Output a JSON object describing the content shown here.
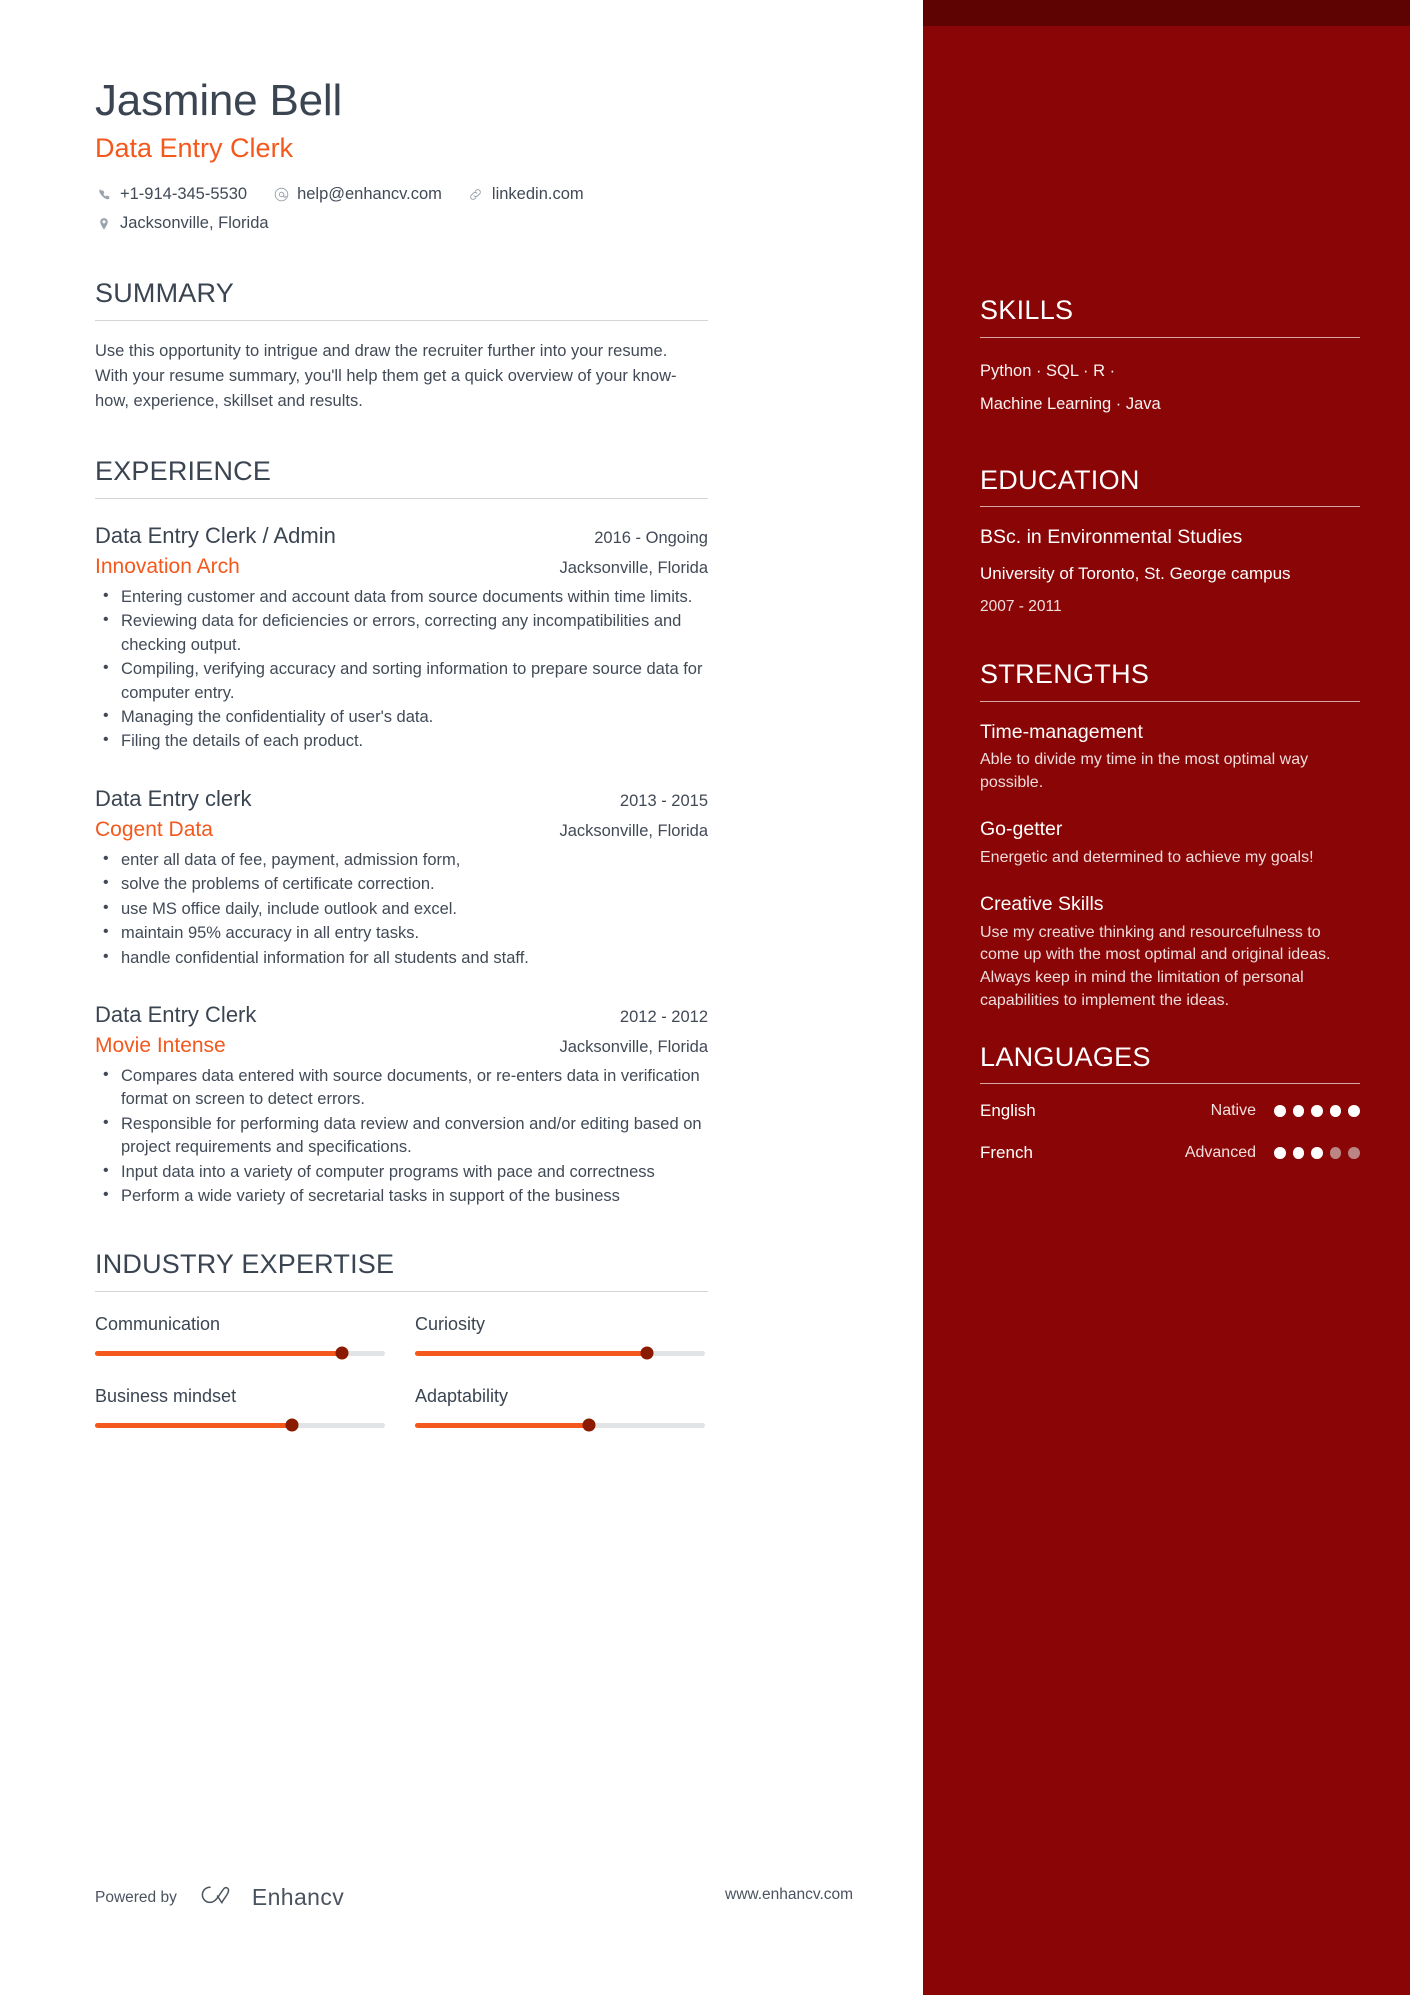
{
  "theme": {
    "accent_orange": "#f4581c",
    "sidebar_red": "#8a0505",
    "sidebar_top_strip": "#5f0202",
    "text_dark": "#3b4552",
    "knob_dark_red": "#8a1a00"
  },
  "header": {
    "name": "Jasmine Bell",
    "role": "Data Entry Clerk",
    "contacts": [
      {
        "icon": "phone-icon",
        "text": "+1-914-345-5530"
      },
      {
        "icon": "email-icon",
        "text": "help@enhancv.com"
      },
      {
        "icon": "link-icon",
        "text": "linkedin.com"
      },
      {
        "icon": "location-icon",
        "text": "Jacksonville, Florida"
      }
    ]
  },
  "summary": {
    "title": "SUMMARY",
    "text": "Use this opportunity to intrigue and draw the recruiter further into your resume. With your resume summary, you'll help them get a quick overview of your know-how, experience, skillset and results."
  },
  "experience": {
    "title": "EXPERIENCE",
    "jobs": [
      {
        "title": "Data Entry Clerk / Admin",
        "dates": "2016 - Ongoing",
        "company": "Innovation Arch",
        "location": "Jacksonville, Florida",
        "bullets": [
          "Entering customer and account data from source documents within time limits.",
          "Reviewing data for deficiencies or errors, correcting any incompatibilities and checking output.",
          "Compiling, verifying accuracy and sorting information to prepare source data for computer entry.",
          "Managing the confidentiality of user's data.",
          "Filing the details of each product."
        ]
      },
      {
        "title": "Data Entry clerk",
        "dates": "2013 - 2015",
        "company": "Cogent Data",
        "location": "Jacksonville, Florida",
        "bullets": [
          "enter all data of fee, payment, admission form,",
          "solve the problems of certificate correction.",
          "use MS office daily, include outlook and excel.",
          "maintain 95% accuracy in all entry tasks.",
          "handle confidential information for all students and staff."
        ]
      },
      {
        "title": "Data Entry Clerk",
        "dates": "2012 - 2012",
        "company": "Movie Intense",
        "location": "Jacksonville, Florida",
        "bullets": [
          "Compares data entered with source documents, or re-enters data in verification format on screen to detect errors.",
          "Responsible for performing data review and conversion and/or editing based on project requirements and specifications.",
          "Input data into a variety of computer programs with pace and correctness",
          "Perform a wide variety of secretarial tasks in support of the business"
        ]
      }
    ]
  },
  "industry_expertise": {
    "title": "INDUSTRY EXPERTISE",
    "items": [
      {
        "label": "Communication",
        "value": 85
      },
      {
        "label": "Curiosity",
        "value": 80
      },
      {
        "label": "Business mindset",
        "value": 68
      },
      {
        "label": "Adaptability",
        "value": 60
      }
    ]
  },
  "sidebar": {
    "skills": {
      "title": "SKILLS",
      "lines": [
        "Python · SQL ·  R  ·",
        "Machine Learning · Java"
      ]
    },
    "education": {
      "title": "EDUCATION",
      "degree": "BSc. in Environmental Studies",
      "school": "University of Toronto, St. George campus",
      "dates": "2007 - 2011"
    },
    "strengths": {
      "title": "STRENGTHS",
      "items": [
        {
          "name": "Time-management",
          "desc": "Able to divide my time in the most optimal way possible."
        },
        {
          "name": "Go-getter",
          "desc": "Energetic and determined to achieve my goals!"
        },
        {
          "name": "Creative Skills",
          "desc": "Use my creative thinking and resourcefulness to come up with the most optimal and original ideas. Always keep in mind the limitation of personal capabilities to implement the ideas."
        }
      ]
    },
    "languages": {
      "title": "LANGUAGES",
      "items": [
        {
          "name": "English",
          "level": "Native",
          "dots_filled": 5,
          "dots_total": 5
        },
        {
          "name": "French",
          "level": "Advanced",
          "dots_filled": 3,
          "dots_total": 5
        }
      ]
    }
  },
  "footer": {
    "powered_by": "Powered by",
    "brand": "Enhancv",
    "url": "www.enhancv.com"
  }
}
